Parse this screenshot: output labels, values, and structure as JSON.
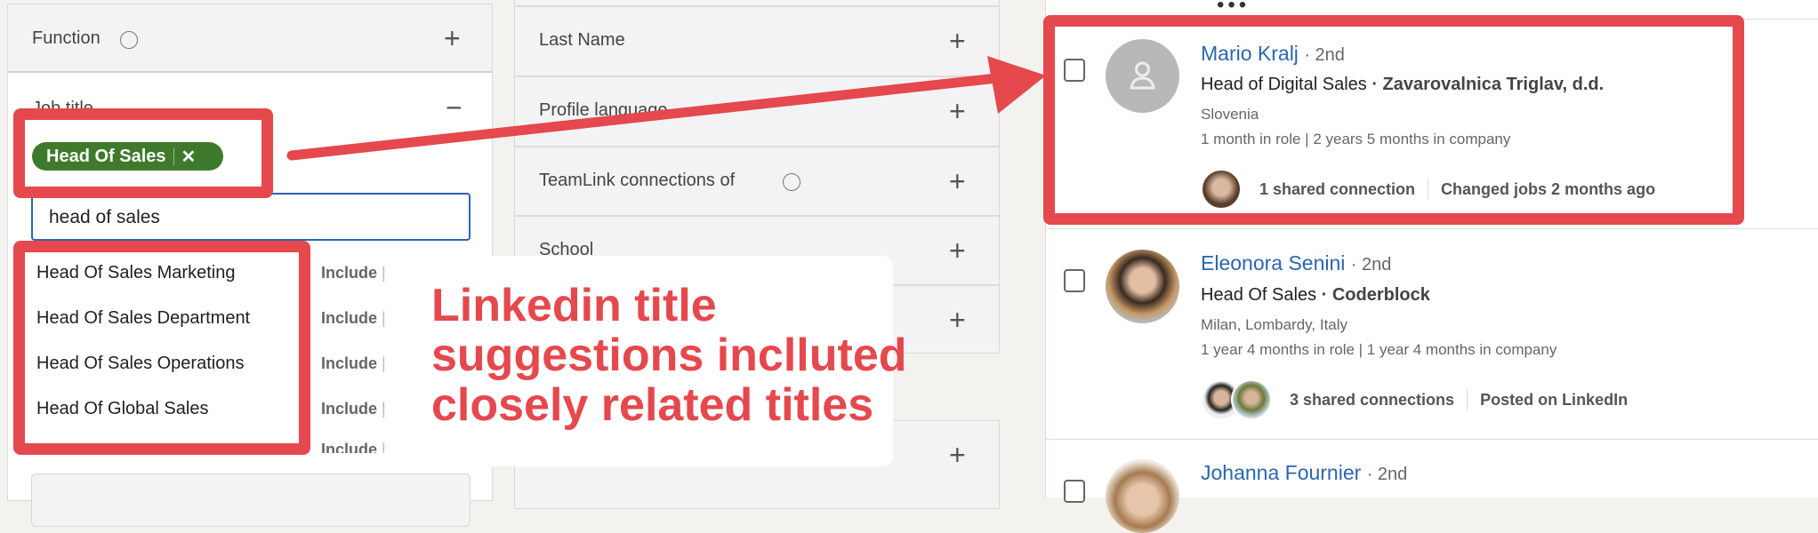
{
  "left_filters": {
    "function_label": "Function",
    "job_title_label": "Job title",
    "selected_chip": "Head Of Sales",
    "search_value": "head of sales",
    "suggestions": [
      {
        "label": "Head Of Sales Marketing",
        "action": "Include"
      },
      {
        "label": "Head Of Sales Department",
        "action": "Include"
      },
      {
        "label": "Head Of Sales Operations",
        "action": "Include"
      },
      {
        "label": "Head Of Global Sales",
        "action": "Include"
      },
      {
        "label": "",
        "action": "Include"
      }
    ]
  },
  "middle_filters": [
    "Last Name",
    "Profile language",
    "TeamLink connections of",
    "School"
  ],
  "annotation": {
    "lines": [
      "Linkedin title",
      "suggestions inclluted",
      "closely related titles"
    ],
    "color": "#e5484d"
  },
  "results": [
    {
      "name": "Mario Kralj",
      "degree": "· 2nd",
      "title": "Head of Digital Sales",
      "company": "· Zavarovalnica Triglav, d.d.",
      "location": "Slovenia",
      "tenure": "1 month in role | 2 years 5 months in company",
      "shared": "1 shared connection",
      "activity": "Changed jobs 2 months ago"
    },
    {
      "name": "Eleonora Senini",
      "degree": "· 2nd",
      "title": "Head Of Sales",
      "company": "· Coderblock",
      "location": "Milan, Lombardy, Italy",
      "tenure": "1 year 4 months in role | 1 year 4 months in company",
      "shared": "3 shared connections",
      "activity": "Posted on LinkedIn"
    },
    {
      "name": "Johanna Fournier",
      "degree": "· 2nd"
    }
  ],
  "colors": {
    "accent_red": "#e5484d",
    "chip_green": "#3f7a2c",
    "link_blue": "#2a66b0"
  }
}
